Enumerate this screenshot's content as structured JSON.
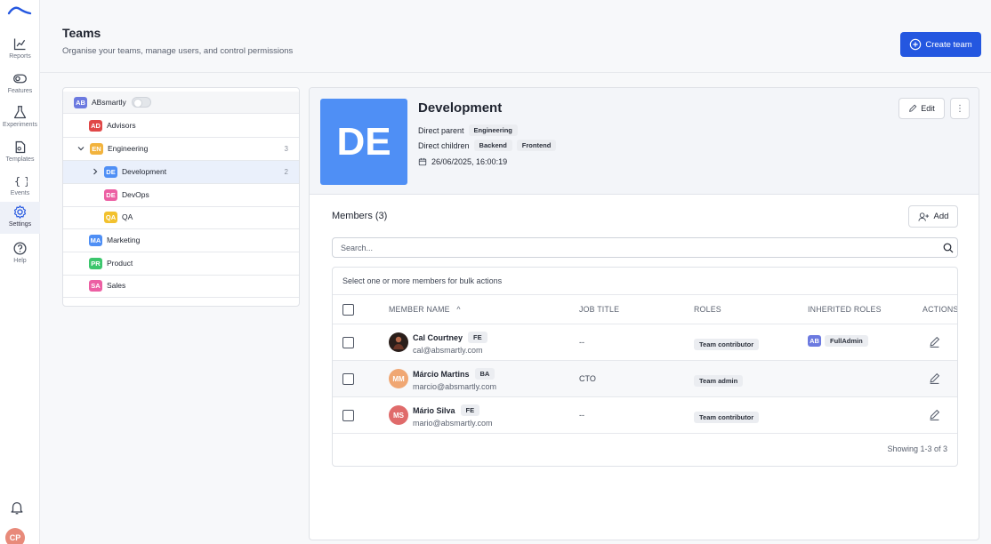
{
  "nav": {
    "items": [
      {
        "label": "Reports",
        "icon": "chart-icon"
      },
      {
        "label": "Features",
        "icon": "toggle-icon"
      },
      {
        "label": "Experiments",
        "icon": "flask-icon"
      },
      {
        "label": "Templates",
        "icon": "template-icon"
      },
      {
        "label": "Events",
        "icon": "braces-icon"
      },
      {
        "label": "Settings",
        "icon": "gear-icon"
      },
      {
        "label": "Help",
        "icon": "help-icon"
      }
    ],
    "active": "Settings",
    "user_initials": "CP"
  },
  "header": {
    "title": "Teams",
    "subtitle": "Organise your teams, manage users, and control permissions",
    "create_label": "Create team"
  },
  "tree": {
    "root": {
      "badge": "AB",
      "label": "ABsmartly",
      "color": "#6c7ae0"
    },
    "rows": [
      {
        "badge": "AD",
        "label": "Advisors",
        "color": "#e04848",
        "count": ""
      },
      {
        "badge": "EN",
        "label": "Engineering",
        "color": "#f2b33d",
        "count": "3"
      },
      {
        "badge": "DE",
        "label": "Development",
        "color": "#4f8ff5",
        "count": "2"
      },
      {
        "badge": "DE",
        "label": "DevOps",
        "color": "#ec5fa3",
        "count": ""
      },
      {
        "badge": "QA",
        "label": "QA",
        "color": "#f2c12e",
        "count": ""
      },
      {
        "badge": "MA",
        "label": "Marketing",
        "color": "#4f8ff5",
        "count": ""
      },
      {
        "badge": "PR",
        "label": "Product",
        "color": "#3cc66d",
        "count": ""
      },
      {
        "badge": "SA",
        "label": "Sales",
        "color": "#ec5fa3",
        "count": ""
      }
    ]
  },
  "team": {
    "initials": "DE",
    "name": "Development",
    "parent_label": "Direct parent",
    "parent": "Engineering",
    "children_label": "Direct children",
    "children": [
      "Backend",
      "Frontend"
    ],
    "created": "26/06/2025, 16:00:19",
    "edit_label": "Edit",
    "more_label": "⋮"
  },
  "members": {
    "title": "Members (3)",
    "add_label": "Add",
    "search_placeholder": "Search...",
    "bulk_text": "Select one or more members for bulk actions",
    "columns": [
      "MEMBER NAME",
      "JOB TITLE",
      "ROLES",
      "INHERITED ROLES",
      "ACTIONS"
    ],
    "sort_indicator": "^",
    "rows": [
      {
        "initials": "",
        "avatar_color": "#2a1e1a",
        "name": "Cal Courtney",
        "tag": "FE",
        "email": "cal@absmartly.com",
        "job": "--",
        "role": "Team contributor",
        "inherited_badge": "AB",
        "inherited_role": "FullAdmin"
      },
      {
        "initials": "MM",
        "avatar_color": "#f0a773",
        "name": "Márcio Martins",
        "tag": "BA",
        "email": "marcio@absmartly.com",
        "job": "CTO",
        "role": "Team admin",
        "inherited_badge": "",
        "inherited_role": ""
      },
      {
        "initials": "MS",
        "avatar_color": "#e06b6b",
        "name": "Mário Silva",
        "tag": "FE",
        "email": "mario@absmartly.com",
        "job": "--",
        "role": "Team contributor",
        "inherited_badge": "",
        "inherited_role": ""
      }
    ],
    "footer": "Showing 1-3 of 3"
  }
}
